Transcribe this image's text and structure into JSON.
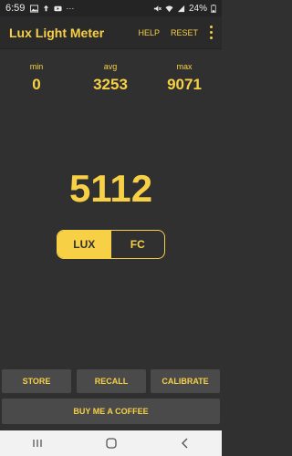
{
  "status_bar": {
    "time": "6:59",
    "battery": "24%",
    "more": "···"
  },
  "app_bar": {
    "title": "Lux Light Meter",
    "help_label": "HELP",
    "reset_label": "RESET"
  },
  "stats": {
    "min_label": "min",
    "min_value": "0",
    "avg_label": "avg",
    "avg_value": "3253",
    "max_label": "max",
    "max_value": "9071"
  },
  "reading": {
    "value": "5112"
  },
  "unit_toggle": {
    "lux_label": "LUX",
    "fc_label": "FC",
    "selected": "LUX"
  },
  "buttons": {
    "store_label": "STORE",
    "recall_label": "RECALL",
    "calibrate_label": "CALIBRATE",
    "coffee_label": "BUY ME A COFFEE"
  },
  "colors": {
    "accent": "#f7d046",
    "background": "#303030",
    "button_bg": "#4a4a4a"
  }
}
